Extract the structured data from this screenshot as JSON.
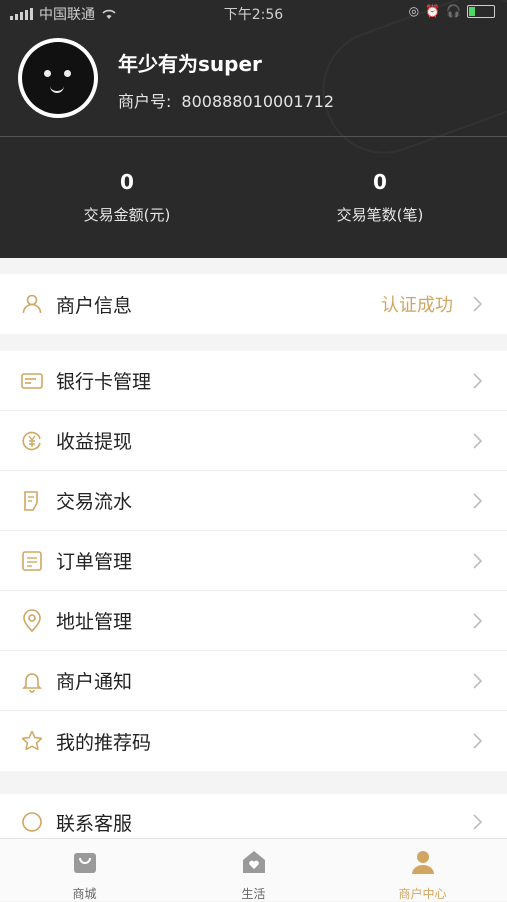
{
  "status_bar": {
    "carrier": "中国联通",
    "time": "下午2:56"
  },
  "profile": {
    "username": "年少有为super",
    "merchant_no_label": "商户号:",
    "merchant_no": "800888010001712"
  },
  "stats": [
    {
      "value": "0",
      "label": "交易金额(元)"
    },
    {
      "value": "0",
      "label": "交易笔数(笔)"
    }
  ],
  "menu": {
    "merchant_info": {
      "label": "商户信息",
      "status": "认证成功",
      "icon": "user-icon"
    },
    "items": [
      {
        "label": "银行卡管理",
        "icon": "bank-card-icon"
      },
      {
        "label": "收益提现",
        "icon": "yuan-withdraw-icon"
      },
      {
        "label": "交易流水",
        "icon": "receipt-icon"
      },
      {
        "label": "订单管理",
        "icon": "order-list-icon"
      },
      {
        "label": "地址管理",
        "icon": "location-pin-icon"
      },
      {
        "label": "商户通知",
        "icon": "bell-icon"
      },
      {
        "label": "我的推荐码",
        "icon": "star-icon"
      }
    ],
    "partial": {
      "label": "联系客服",
      "icon": "headset-icon"
    }
  },
  "tabbar": {
    "tabs": [
      {
        "label": "商城",
        "icon": "shop-bag-icon",
        "active": false
      },
      {
        "label": "生活",
        "icon": "home-heart-icon",
        "active": false
      },
      {
        "label": "商户中心",
        "icon": "profile-icon",
        "active": true
      }
    ]
  },
  "colors": {
    "accent": "#d1a662",
    "header_bg": "#2a2a2a"
  }
}
